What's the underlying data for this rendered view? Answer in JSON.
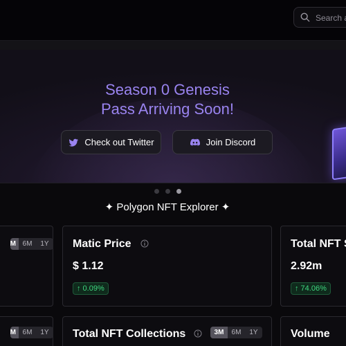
{
  "search": {
    "placeholder": "Search a"
  },
  "hero": {
    "title_line1": "Season 0 Genesis",
    "title_line2": "Pass Arriving Soon!",
    "twitter_label": "Check out Twitter",
    "discord_label": "Join Discord"
  },
  "carousel": {
    "count": 3,
    "active_index": 2
  },
  "explorer": {
    "title": "✦ Polygon NFT Explorer ✦"
  },
  "ranges": [
    "3M",
    "6M",
    "1Y"
  ],
  "cards": {
    "left_top": {
      "active_range": "3M"
    },
    "matic": {
      "title": "Matic Price",
      "value": "$ 1.12",
      "change": "↑ 0.09%"
    },
    "total_top": {
      "title": "Total NFT S",
      "value": "2.92m",
      "change": "↑ 74.06%"
    },
    "left_bottom": {
      "active_range": "3M"
    },
    "collections": {
      "title": "Total NFT Collections",
      "active_range": "3M"
    },
    "volume": {
      "title": "Volume"
    }
  },
  "colors": {
    "accent": "#9a84f0",
    "positive": "#3fd67f"
  }
}
